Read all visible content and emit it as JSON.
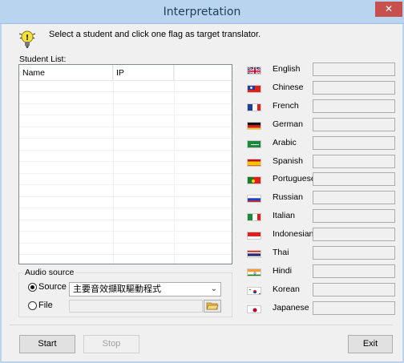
{
  "window": {
    "title": "Interpretation",
    "close_glyph": "✕"
  },
  "header": {
    "icon": "lightbulb-warning-icon",
    "instruction": "Select a student and click one flag as target translator."
  },
  "student_list": {
    "label": "Student List:",
    "columns": [
      "Name",
      "IP"
    ],
    "rows": []
  },
  "audio_source": {
    "legend": "Audio source",
    "source_label": "Source",
    "source_selected": true,
    "source_value": "主要音效擷取驅動程式",
    "file_label": "File",
    "file_selected": false,
    "file_value": "",
    "browse_icon": "folder-open-icon"
  },
  "languages": [
    {
      "name": "English",
      "flag": "uk"
    },
    {
      "name": "Chinese",
      "flag": "tw"
    },
    {
      "name": "French",
      "flag": "fr"
    },
    {
      "name": "German",
      "flag": "de"
    },
    {
      "name": "Arabic",
      "flag": "sa"
    },
    {
      "name": "Spanish",
      "flag": "es"
    },
    {
      "name": "Portuguese",
      "flag": "pt"
    },
    {
      "name": "Russian",
      "flag": "ru"
    },
    {
      "name": "Italian",
      "flag": "it"
    },
    {
      "name": "Indonesian",
      "flag": "id"
    },
    {
      "name": "Thai",
      "flag": "th"
    },
    {
      "name": "Hindi",
      "flag": "in"
    },
    {
      "name": "Korean",
      "flag": "kr"
    },
    {
      "name": "Japanese",
      "flag": "jp"
    }
  ],
  "buttons": {
    "start": "Start",
    "stop": "Stop",
    "exit": "Exit"
  },
  "colors": {
    "titlebar": "#b8d4ef",
    "close": "#c7504e"
  }
}
